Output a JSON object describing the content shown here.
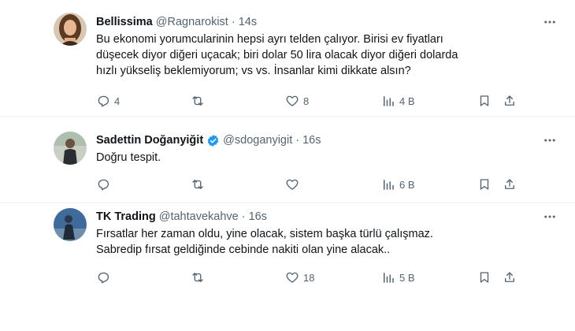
{
  "tweets": [
    {
      "name": "Bellissima",
      "handle": "@Ragnarokist",
      "time": "14s",
      "verified": false,
      "text": "Bu ekonomi yorumcularinin hepsi ayrı telden çalıyor. Birisi ev fiyatları\ndüşecek diyor diğeri uçacak; biri dolar 50 lira olacak diyor diğeri dolarda\nhızlı yükseliş beklemiyorum; vs vs. İnsanlar kimi dikkate alsın?",
      "replies": "4",
      "retweets": "",
      "likes": "8",
      "views": "4 B"
    },
    {
      "name": "Sadettin Doğanyiğit",
      "handle": "@sdoganyigit",
      "time": "16s",
      "verified": true,
      "text": "Doğru tespit.",
      "replies": "",
      "retweets": "",
      "likes": "",
      "views": "6 B"
    },
    {
      "name": "TK Trading",
      "handle": "@tahtavekahve",
      "time": "16s",
      "verified": false,
      "text": "Fırsatlar her zaman oldu, yine olacak, sistem başka türlü çalışmaz.\nSabredip fırsat geldiğinde cebinde nakiti olan yine alacak..",
      "replies": "",
      "retweets": "",
      "likes": "18",
      "views": "5 B"
    }
  ],
  "separator": "·",
  "colors": {
    "text": "#0f1419",
    "secondary": "#536471",
    "verified": "#1d9bf0",
    "divider": "#eff3f4"
  },
  "icons": [
    "reply-icon",
    "retweet-icon",
    "like-icon",
    "views-icon",
    "bookmark-icon",
    "share-icon",
    "more-icon",
    "verified-badge-icon"
  ]
}
